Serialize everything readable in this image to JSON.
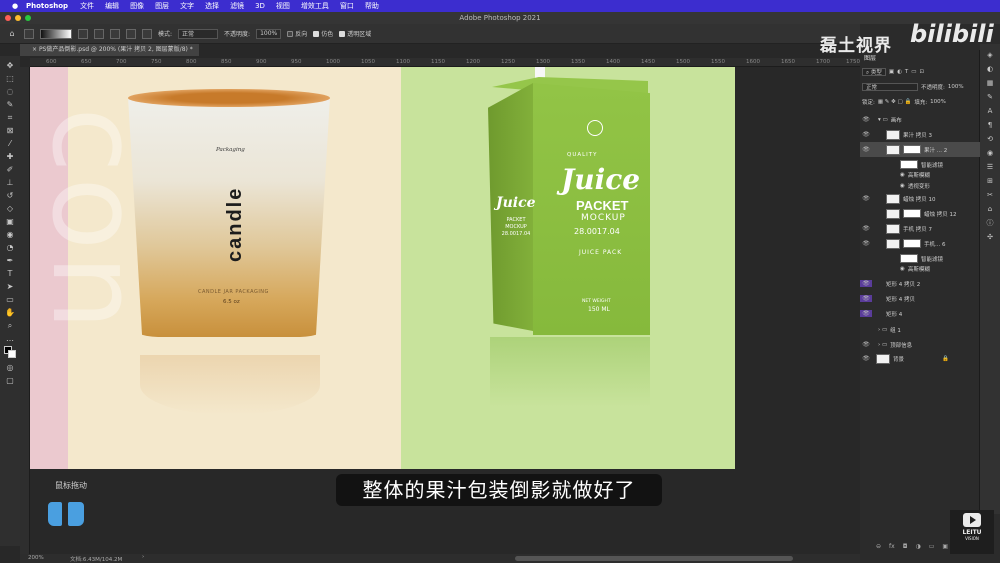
{
  "menubar": {
    "app_name": "Photoshop",
    "items": [
      "文件",
      "编辑",
      "图像",
      "图层",
      "文字",
      "选择",
      "滤镜",
      "3D",
      "视图",
      "增效工具",
      "窗口",
      "帮助"
    ]
  },
  "window": {
    "title": "Adobe Photoshop 2021"
  },
  "options": {
    "mode_label": "模式:",
    "mode_value": "正常",
    "opacity_label": "不透明度:",
    "opacity_value": "100%",
    "reverse": "反向",
    "dither": "仿色",
    "transparency": "透明区域"
  },
  "document_tab": {
    "label": "PS做产品倒影.psd @ 200% (果汁 拷贝 2, 图层蒙版/8) *"
  },
  "ruler": {
    "ticks": [
      "600",
      "650",
      "700",
      "750",
      "800",
      "850",
      "900",
      "950",
      "1000",
      "1050",
      "1100",
      "1150",
      "1200",
      "1250",
      "1300",
      "1350",
      "1400",
      "1450",
      "1500",
      "1550",
      "1600",
      "1650",
      "1700",
      "1750"
    ]
  },
  "canvas": {
    "candle": {
      "word": "candle",
      "big_letters": "con",
      "brand": "Packaging",
      "sub": "CANDLE JAR PACKAGING",
      "weight": "6.5 oz"
    },
    "juice": {
      "quality": "QUALITY",
      "title": "Juice",
      "packet": "PACKET",
      "mockup": "MOCKUP",
      "date": "28.0017.04",
      "pack": "JUICE PACK",
      "net_weight": "NET WEIGHT",
      "volume": "150 ML",
      "side_title": "Juice",
      "side_text": "PACKET MOCKUP 28.0017.04"
    }
  },
  "overlay": {
    "mouse_label": "鼠标拖动",
    "subtitle": "整体的果汁包装倒影就做好了"
  },
  "status": {
    "zoom": "200%",
    "doc": "文档:6.43M/104.2M",
    "arrow": "›"
  },
  "layers_panel": {
    "title": "图层",
    "kind": "类型",
    "blend": "正常",
    "opacity_label": "不透明度:",
    "opacity": "100%",
    "lock_label": "锁定:",
    "fill_label": "填充:",
    "fill": "100%",
    "layers": [
      {
        "name": "画布",
        "type": "group"
      },
      {
        "name": "果汁 拷贝 3",
        "type": "layer"
      },
      {
        "name": "果汁 ... 2",
        "type": "layer"
      },
      {
        "name": "智能滤镜",
        "type": "sub"
      },
      {
        "name": "高斯模糊",
        "type": "sub2"
      },
      {
        "name": "透视变形",
        "type": "sub2"
      },
      {
        "name": "蜡烛 拷贝 10",
        "type": "layer"
      },
      {
        "name": "蜡烛 拷贝 12",
        "type": "layer"
      },
      {
        "name": "手机 拷贝 7",
        "type": "layer"
      },
      {
        "name": "手机... 6",
        "type": "layer"
      },
      {
        "name": "智能滤镜",
        "type": "sub"
      },
      {
        "name": "高斯模糊",
        "type": "sub2"
      },
      {
        "name": "矩形 4 拷贝 2",
        "type": "layer"
      },
      {
        "name": "矩形 4 拷贝",
        "type": "layer"
      },
      {
        "name": "矩形 4",
        "type": "layer"
      },
      {
        "name": "组 1",
        "type": "group"
      },
      {
        "name": "顶部信息",
        "type": "group"
      },
      {
        "name": "背景",
        "type": "layer"
      }
    ],
    "bottom_icons": [
      "⊖",
      "fx",
      "◘",
      "◑",
      "▭",
      "▣",
      "🗑"
    ]
  },
  "watermarks": {
    "channel": "磊土视界",
    "site": "bilibili",
    "leitu": "LEITU",
    "leitu_sub": "VISION"
  },
  "colors": {
    "menubar": "#3c2dcf",
    "pink_strip": "#ebc9cf",
    "cream_bg": "#f4e8cc",
    "green_bg": "#c8e39c",
    "juice_box": "#8cc043"
  }
}
